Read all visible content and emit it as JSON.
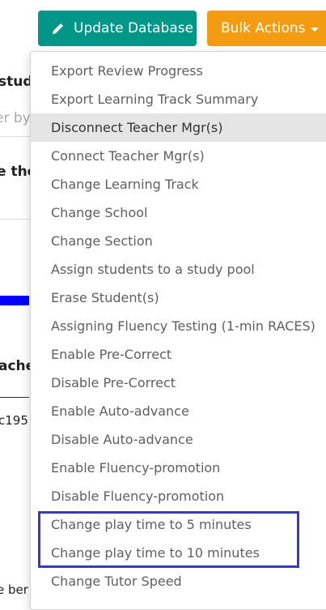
{
  "toolbar": {
    "update_label": "Update Database",
    "update_icon": "pencil-icon",
    "bulk_label": "Bulk Actions",
    "bulk_icon": "caret-down-icon",
    "update_color": "#009688",
    "bulk_color": "#f39c12"
  },
  "background": {
    "fragment_1": "stud",
    "fragment_2": "er by",
    "fragment_3": "e the",
    "fragment_4": "ache",
    "fragment_5": "c195",
    "fragment_6": "e ber"
  },
  "menu": {
    "items": [
      {
        "label": "Export Review Progress"
      },
      {
        "label": "Export Learning Track Summary"
      },
      {
        "label": "Disconnect Teacher Mgr(s)",
        "active": true
      },
      {
        "label": "Connect Teacher Mgr(s)"
      },
      {
        "label": "Change Learning Track"
      },
      {
        "label": "Change School"
      },
      {
        "label": "Change Section"
      },
      {
        "label": "Assign students to a study pool"
      },
      {
        "label": "Erase Student(s)"
      },
      {
        "label": "Assigning Fluency Testing (1-min RACES)"
      },
      {
        "label": "Enable Pre-Correct"
      },
      {
        "label": "Disable Pre-Correct"
      },
      {
        "label": "Enable Auto-advance"
      },
      {
        "label": "Disable Auto-advance"
      },
      {
        "label": "Enable Fluency-promotion"
      },
      {
        "label": "Disable Fluency-promotion"
      },
      {
        "label": "Change play time to 5 minutes"
      },
      {
        "label": "Change play time to 10 minutes"
      },
      {
        "label": "Change Tutor Speed"
      }
    ]
  }
}
